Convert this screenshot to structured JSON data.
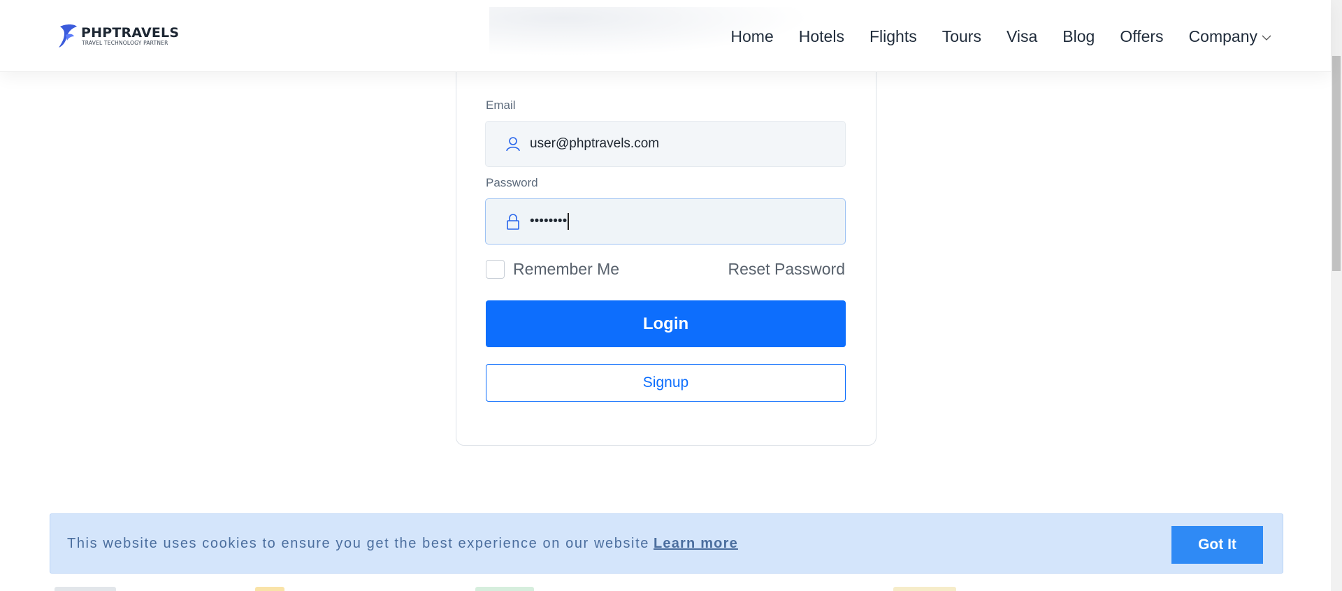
{
  "header": {
    "logo_name": "PHPTRAVELS",
    "logo_tagline": "TRAVEL TECHNOLOGY PARTNER",
    "nav": [
      "Home",
      "Hotels",
      "Flights",
      "Tours",
      "Visa",
      "Blog",
      "Offers",
      "Company"
    ]
  },
  "login": {
    "email_label": "Email",
    "email_value": "user@phptravels.com",
    "password_label": "Password",
    "password_value": "••••••••",
    "remember_label": "Remember Me",
    "reset_label": "Reset Password",
    "login_button": "Login",
    "signup_button": "Signup"
  },
  "cookie": {
    "text": "This website uses cookies to ensure you get the best experience on our website",
    "link": "Learn more",
    "button": "Got It"
  },
  "colors": {
    "primary": "#0d6efd",
    "cookie_bg": "#d4e5fb",
    "cookie_button": "#2f8af5"
  }
}
